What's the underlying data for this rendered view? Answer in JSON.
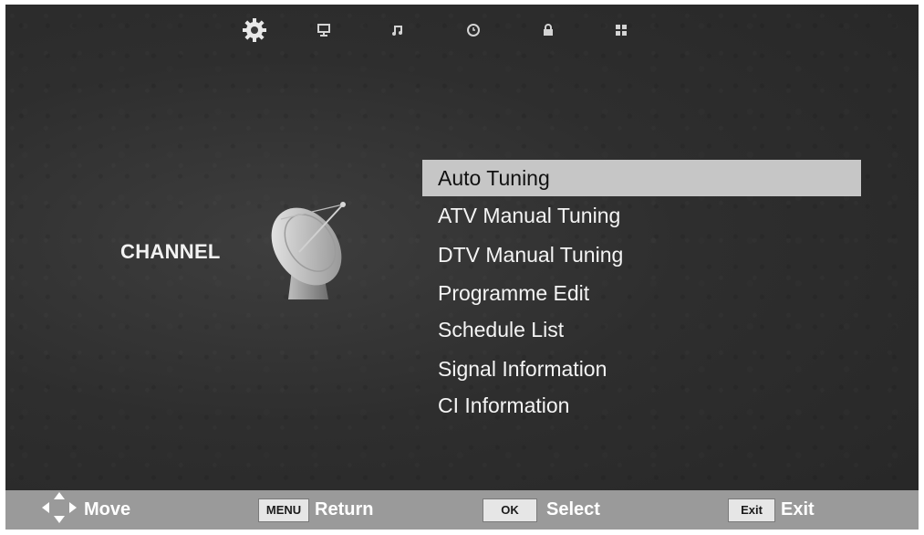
{
  "top_icons": [
    {
      "name": "gear-icon",
      "active": true
    },
    {
      "name": "monitor-icon",
      "active": false
    },
    {
      "name": "music-note-icon",
      "active": false
    },
    {
      "name": "clock-icon",
      "active": false
    },
    {
      "name": "lock-icon",
      "active": false
    },
    {
      "name": "grid-icon",
      "active": false
    }
  ],
  "category": {
    "label": "CHANNEL",
    "icon": "satellite-dish-icon"
  },
  "menu": {
    "items": [
      {
        "label": "Auto Tuning",
        "selected": true
      },
      {
        "label": "ATV Manual Tuning",
        "selected": false
      },
      {
        "label": "DTV Manual Tuning",
        "selected": false
      },
      {
        "label": "Programme Edit",
        "selected": false
      },
      {
        "label": "Schedule List",
        "selected": false
      },
      {
        "label": "Signal Information",
        "selected": false
      },
      {
        "label": "CI Information",
        "selected": false
      }
    ]
  },
  "bottom_bar": {
    "move": {
      "icon": "arrow-keys-icon",
      "label": "Move"
    },
    "return": {
      "key": "MENU",
      "label": "Return"
    },
    "select": {
      "key": "OK",
      "label": "Select"
    },
    "exit": {
      "key": "Exit",
      "label": "Exit"
    }
  },
  "colors": {
    "background": "#2e2e2e",
    "selected_highlight": "#c6c6c6",
    "bottom_bar": "#9a9a9a",
    "text": "#f4f4f4"
  }
}
